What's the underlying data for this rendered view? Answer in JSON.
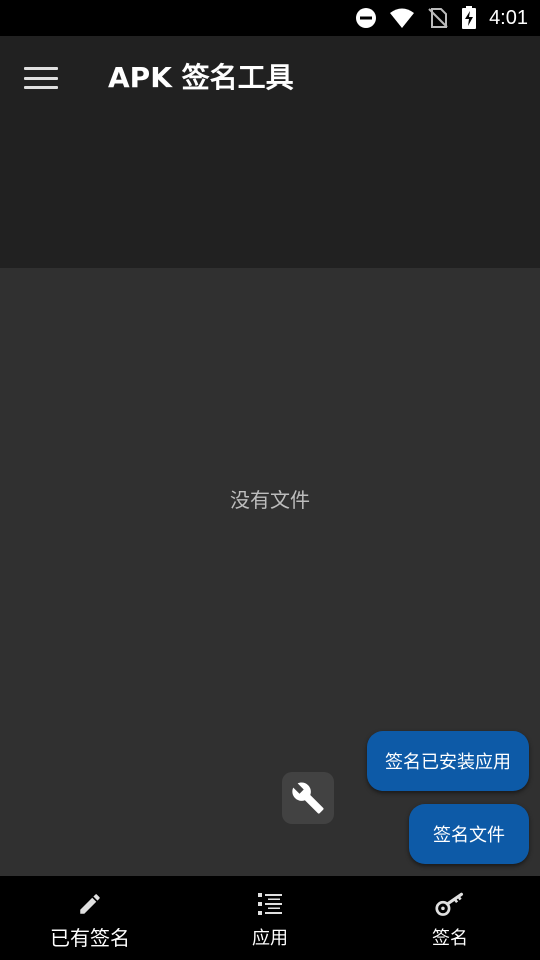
{
  "status_bar": {
    "time": "4:01",
    "icons": [
      "do-not-disturb-icon",
      "wifi-icon",
      "no-sim-icon",
      "battery-charging-icon"
    ]
  },
  "app_bar": {
    "title": "APK 签名工具",
    "menu_icon": "hamburger-menu-icon"
  },
  "content": {
    "empty_text": "没有文件"
  },
  "fabs": {
    "tool_icon": "wrench-icon",
    "sign_installed_label": "签名已安装应用",
    "sign_file_label": "签名文件"
  },
  "bottom_nav": {
    "items": [
      {
        "label": "已有签名",
        "icon": "pencil-icon",
        "active": true
      },
      {
        "label": "应用",
        "icon": "list-icon",
        "active": false
      },
      {
        "label": "签名",
        "icon": "key-icon",
        "active": false
      }
    ]
  },
  "colors": {
    "accent": "#0d5aa7",
    "app_bar": "#212121",
    "background": "#303030"
  }
}
